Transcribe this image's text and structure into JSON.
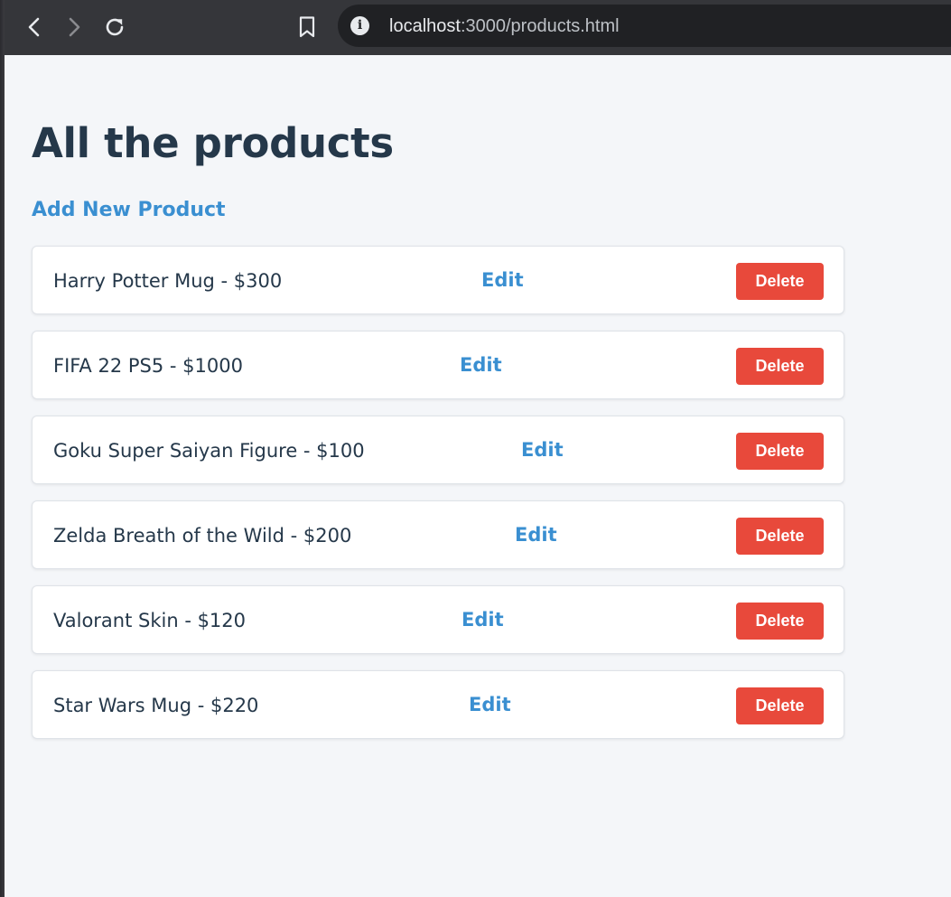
{
  "browser": {
    "url_host": "localhost",
    "url_rest": ":3000/products.html"
  },
  "page": {
    "title": "All the products",
    "add_link": "Add New Product",
    "edit_label": "Edit",
    "delete_label": "Delete"
  },
  "products": [
    {
      "label": "Harry Potter Mug - $300"
    },
    {
      "label": "FIFA 22 PS5 - $1000"
    },
    {
      "label": "Goku Super Saiyan Figure - $100"
    },
    {
      "label": "Zelda Breath of the Wild - $200"
    },
    {
      "label": "Valorant Skin - $120"
    },
    {
      "label": "Star Wars Mug - $220"
    }
  ],
  "colors": {
    "heading": "#25384a",
    "link": "#3a8fd1",
    "delete": "#e8493b",
    "background": "#f4f6f9"
  }
}
